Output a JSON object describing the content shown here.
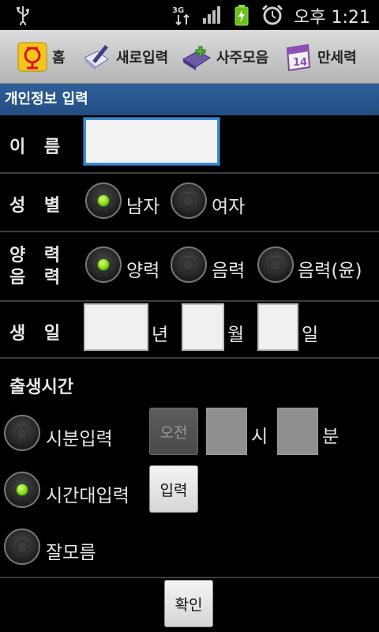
{
  "status_bar": {
    "time": "오후 1:21",
    "network": "3G",
    "icons": [
      "usb-icon",
      "network-3g-icon",
      "signal-icon",
      "battery-charging-icon",
      "alarm-icon"
    ]
  },
  "toolbar": {
    "items": [
      {
        "label": "홈",
        "icon": "home-icon"
      },
      {
        "label": "새로입력",
        "icon": "new-entry-icon"
      },
      {
        "label": "사주모음",
        "icon": "saju-book-icon"
      },
      {
        "label": "만세력",
        "icon": "calendar-icon"
      }
    ]
  },
  "section": {
    "title": "개인정보 입력"
  },
  "form": {
    "name_label": "이 름",
    "name_value": "",
    "gender_label": "성 별",
    "gender_options": [
      "남자",
      "여자"
    ],
    "gender_selected": "남자",
    "calendar_label_line1": "양 력",
    "calendar_label_line2": "음 력",
    "calendar_options": [
      "양력",
      "음력",
      "음력(윤)"
    ],
    "calendar_selected": "양력",
    "birth_label": "생 일",
    "year_unit": "년",
    "month_unit": "월",
    "day_unit": "일",
    "birth_time_title": "출생시간",
    "time_modes": [
      "시분입력",
      "시간대입력",
      "잘모름"
    ],
    "time_mode_selected": "시간대입력",
    "ampm_button": "오전",
    "hour_unit": "시",
    "minute_unit": "분",
    "input_button": "입력",
    "confirm_button": "확인"
  },
  "colors": {
    "section_header": "#2a5790",
    "radio_checked": "#7ed313",
    "focus_border": "#3d8ad0"
  }
}
